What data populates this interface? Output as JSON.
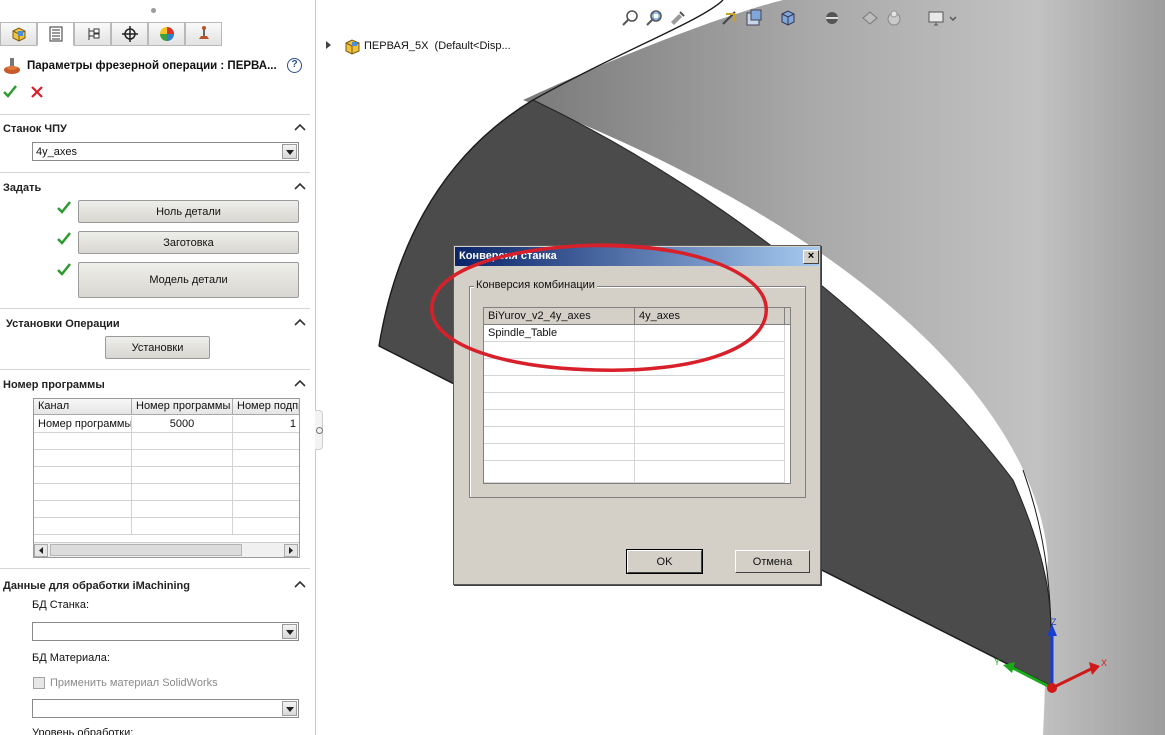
{
  "panel": {
    "tabs": [
      "feature-manager-icon",
      "property-manager-icon",
      "configuration-manager-icon",
      "target-icon",
      "display-manager-icon",
      "cam-icon"
    ],
    "title": "Параметры фрезерной операции : ПЕРВА...",
    "help": "?"
  },
  "sections": {
    "machine": {
      "title": "Станок ЧПУ",
      "selected": "4у_axes"
    },
    "define": {
      "title": "Задать",
      "part_zero": "Ноль детали",
      "stock": "Заготовка",
      "part_model": "Модель детали"
    },
    "setups": {
      "title": "Установки Операции",
      "button": "Установки"
    },
    "program": {
      "title": "Номер программы",
      "columns": [
        "Канал",
        "Номер программы",
        "Номер подпро"
      ],
      "rows": [
        [
          "Номер программы",
          "5000",
          "1"
        ]
      ]
    },
    "imachining": {
      "title": "Данные для обработки iMachining",
      "machine_db_label": "БД Станка:",
      "machine_db_value": "",
      "material_db_label": "БД Материала:",
      "apply_material_label": "Применить материал SolidWorks",
      "material_db_value": "",
      "level_label": "Уровень обработки:"
    }
  },
  "tree": {
    "name": "ПЕРВАЯ_5X",
    "config": "(Default<Disp..."
  },
  "dialog": {
    "title": "Конверсия станка",
    "group_label": "Конверсия комбинации",
    "columns": [
      "BiYurov_v2_4y_axes",
      "4у_axes"
    ],
    "rows": [
      [
        "Spindle_Table",
        ""
      ]
    ],
    "ok": "OK",
    "cancel": "Отмена"
  },
  "axes": {
    "x": "X",
    "y": "Y",
    "z": "Z"
  },
  "colors": {
    "annotation_red": "#d8202a",
    "check_green": "#2f9a2f",
    "dialog_title_start": "#0a246a",
    "dialog_title_end": "#a6caf0",
    "model_dark": "#4d4d4d",
    "model_light": "#b8b8b8"
  }
}
